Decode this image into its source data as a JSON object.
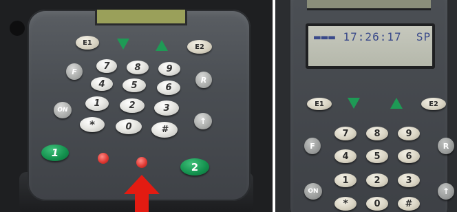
{
  "left_photo": {
    "keys": {
      "e1": "E1",
      "e2": "E2",
      "f": "F",
      "r": "R",
      "on": "ON",
      "n7": "7",
      "n8": "8",
      "n9": "9",
      "n4": "4",
      "n5": "5",
      "n6": "6",
      "n1": "1",
      "n2": "2",
      "n3": "3",
      "star": "*",
      "n0": "0",
      "hash": "#",
      "up": "↑",
      "green1": "1",
      "green2": "2"
    },
    "annotation_arrow_color": "#e31b12",
    "key_accent_color": "#13904d",
    "led_color": "#e13a34"
  },
  "right_photo": {
    "lcd_text": "▬▬▬ 17:26:17  SP",
    "keys": {
      "e1": "E1",
      "e2": "E2",
      "f": "F",
      "r": "R",
      "on": "ON",
      "n7": "7",
      "n8": "8",
      "n9": "9",
      "n4": "4",
      "n5": "5",
      "n6": "6",
      "n1": "1",
      "n2": "2",
      "n3": "3",
      "star": "*",
      "n0": "0",
      "hash": "#",
      "up": "↑"
    },
    "lcd_text_color": "#3a4a8a"
  }
}
